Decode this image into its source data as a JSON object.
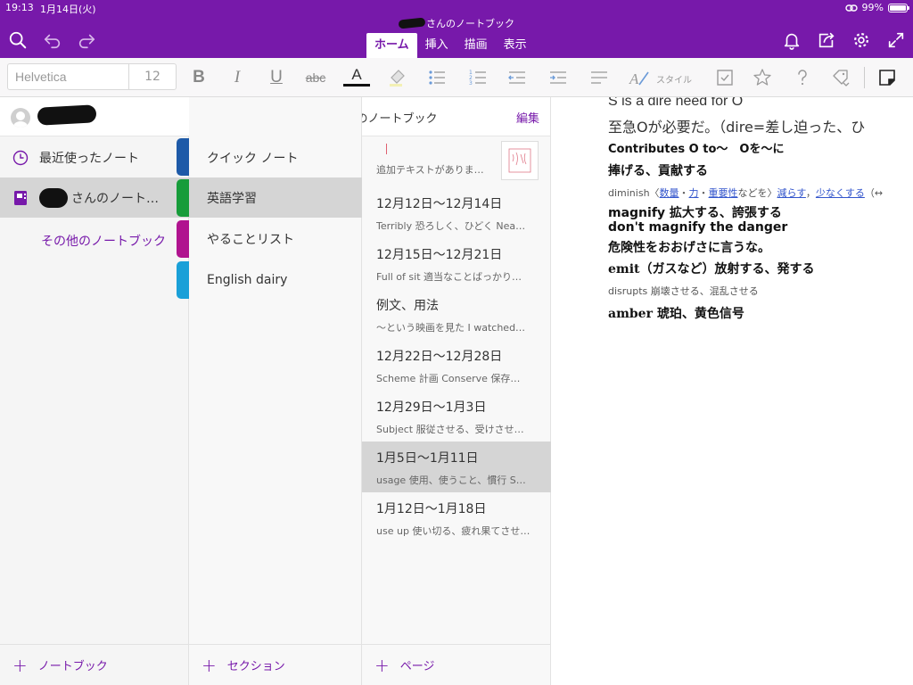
{
  "status_bar": {
    "time": "19:13",
    "date": "1月14日(火)",
    "battery": "99%"
  },
  "header": {
    "notebook_title": "さんのノートブック",
    "tabs": [
      {
        "label": "ホーム",
        "active": true
      },
      {
        "label": "挿入",
        "active": false
      },
      {
        "label": "描画",
        "active": false
      },
      {
        "label": "表示",
        "active": false
      }
    ],
    "icons_left": [
      "search-icon",
      "undo-icon",
      "redo-icon"
    ],
    "icons_right": [
      "bell-icon",
      "share-icon",
      "gear-icon",
      "fullscreen-icon"
    ]
  },
  "ribbon": {
    "font_name": "Helvetica",
    "font_size": "12",
    "bold": "B",
    "italic": "I",
    "underline": "U",
    "strike": "abc",
    "font_color": "A",
    "style_label": "スタイル"
  },
  "notebooks": {
    "recent_label": "最近使ったノート",
    "current_notebook": "さんのノート…",
    "other_label": "その他のノートブック",
    "add_label": "ノートブック"
  },
  "section_header": {
    "title": "さんのノートブック",
    "edit_label": "編集"
  },
  "sections": {
    "items": [
      {
        "label": "クイック ノート",
        "color": "#1e5aa8"
      },
      {
        "label": "英語学習",
        "color": "#179c3a"
      },
      {
        "label": "やることリスト",
        "color": "#b0138f"
      },
      {
        "label": "English dairy",
        "color": "#1aa0d8"
      }
    ],
    "add_label": "セクション"
  },
  "pages": {
    "first_subtitle": "追加テキストがありま…",
    "items": [
      {
        "title": "12月12日〜12月14日",
        "subtitle": "Terribly 恐ろしく、ひどく Nea…"
      },
      {
        "title": "12月15日〜12月21日",
        "subtitle": "Full of sit 適当なことばっかり…"
      },
      {
        "title": "例文、用法",
        "subtitle": "〜という映画を見た I watched…"
      },
      {
        "title": "12月22日〜12月28日",
        "subtitle": "Scheme 計画 Conserve 保存…"
      },
      {
        "title": "12月29日〜1月3日",
        "subtitle": "Subject 服従させる、受けさせ…"
      },
      {
        "title": "1月5日〜1月11日",
        "subtitle": "usage 使用、使うこと、慣行 S…"
      },
      {
        "title": "1月12日〜1月18日",
        "subtitle": "use up 使い切る、疲れ果てさせ…"
      }
    ],
    "add_label": "ページ"
  },
  "note": {
    "line1": "S is a dire need for O",
    "line2": "至急Oが必要だ。（dire=差し迫った、ひ",
    "line3": "Contributes O to〜　Oを〜に",
    "line4": "捧げる、貢献する",
    "line5_prefix": "diminish〈",
    "line5_link1": "数量",
    "line5_sep1": "・",
    "line5_link2": "力",
    "line5_sep2": "・",
    "line5_link3": "重要性",
    "line5_mid": "などを〉",
    "line5_link4": "減らす",
    "line5_sep3": "，",
    "line5_link5": "少なくする",
    "line5_suffix": "（↔",
    "line6": "magnify 拡大する、誇張する",
    "line7": "don't magnify the danger",
    "line8": "危険性をおおげさに言うな。",
    "line9": "emit（ガスなど）放射する、発する",
    "line10": "disrupts 崩壊させる、混乱させる",
    "line11": "amber 琥珀、黄色信号"
  },
  "colors": {
    "accent": "#7719aa",
    "selected_row": "#d5d5d5"
  }
}
